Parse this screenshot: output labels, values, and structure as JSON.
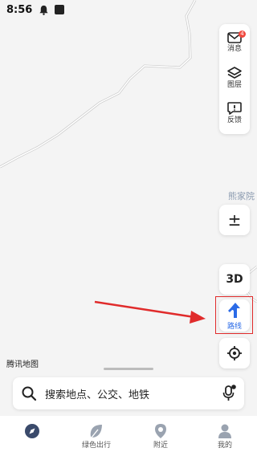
{
  "status_bar": {
    "time": "8:56"
  },
  "toolbar": {
    "messages_label": "消息",
    "messages_badge": "4",
    "layers_label": "图层",
    "feedback_label": "反馈"
  },
  "map": {
    "place_label": "熊家院",
    "brand": "腾讯地图"
  },
  "controls": {
    "zoom_label": "±",
    "threed_label": "3D",
    "route_label": "路线"
  },
  "search": {
    "placeholder": "搜索地点、公交、地铁"
  },
  "tabs": [
    {
      "label": ""
    },
    {
      "label": "绿色出行"
    },
    {
      "label": "附近"
    },
    {
      "label": "我的"
    }
  ],
  "colors": {
    "accent": "#2b6be7",
    "annotation_red": "#e02b2b",
    "badge": "#f0483e"
  }
}
